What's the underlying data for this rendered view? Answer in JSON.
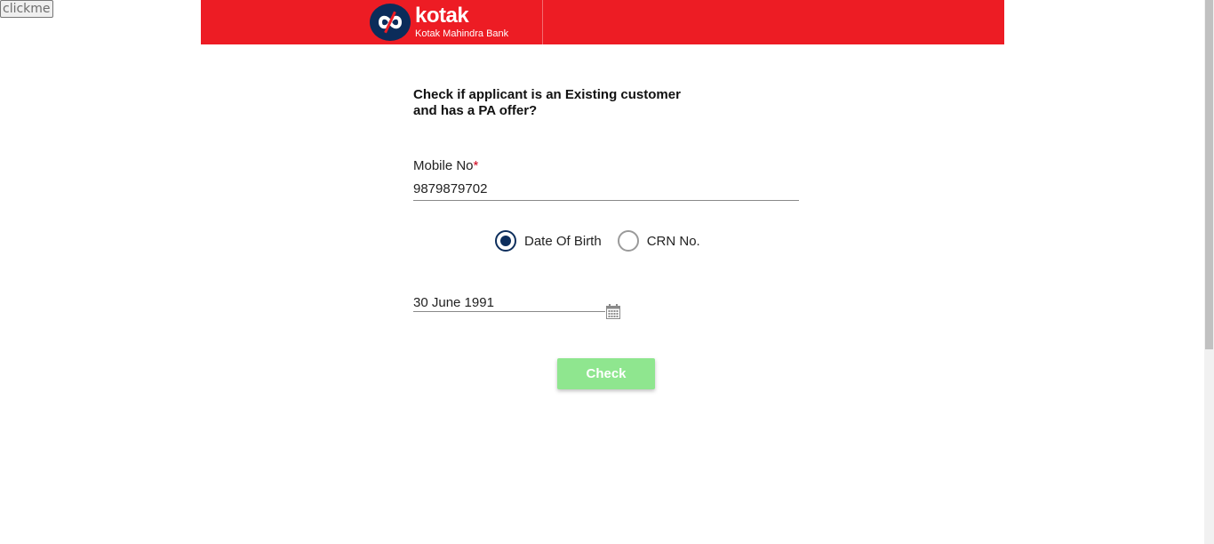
{
  "debug_button": {
    "label": "clickme"
  },
  "header": {
    "brand_name": "kotak",
    "brand_subtitle": "Kotak Mahindra Bank",
    "brand_color": "#ed1c24",
    "logo_icon": "kotak-infinity-logo"
  },
  "form": {
    "question_line1": "Check if applicant is an Existing customer",
    "question_line2": "and has a PA offer?",
    "mobile": {
      "label": "Mobile No",
      "required_marker": "*",
      "value": "9879879702"
    },
    "id_type": {
      "options": [
        {
          "label": "Date Of Birth",
          "selected": true
        },
        {
          "label": "CRN No.",
          "selected": false
        }
      ]
    },
    "dob": {
      "value": "30 June 1991",
      "icon": "calendar-icon"
    },
    "check_button": {
      "label": "Check",
      "color": "#8fe68f"
    }
  },
  "colors": {
    "radio_selected": "#0d2e5c",
    "required_marker": "#d0021b"
  }
}
